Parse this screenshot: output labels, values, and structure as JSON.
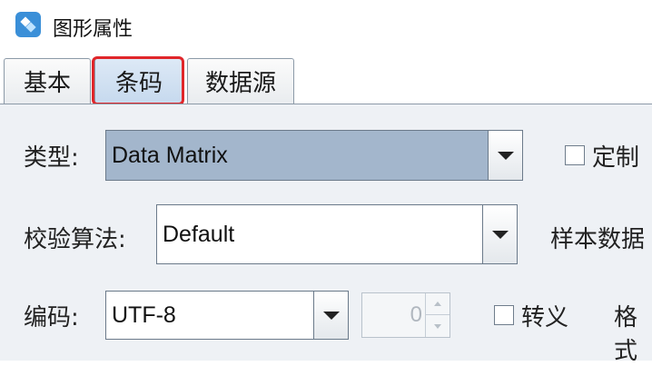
{
  "window": {
    "title": "图形属性"
  },
  "tabs": [
    {
      "label": "基本"
    },
    {
      "label": "条码"
    },
    {
      "label": "数据源"
    }
  ],
  "form": {
    "type": {
      "label": "类型:",
      "value": "Data Matrix"
    },
    "custom": {
      "label": "定制",
      "checked": false
    },
    "checksum": {
      "label": "校验算法:",
      "value": "Default"
    },
    "sample_data": {
      "label": "样本数据"
    },
    "encoding": {
      "label": "编码:",
      "value": "UTF-8"
    },
    "number": {
      "value": "0"
    },
    "escape": {
      "label": "转义",
      "checked": false
    },
    "format": {
      "label": "格式"
    }
  },
  "colors": {
    "highlight": "#e0262a",
    "selected_combo": "#a3b6cc",
    "panel_bg": "#eef1f5"
  }
}
